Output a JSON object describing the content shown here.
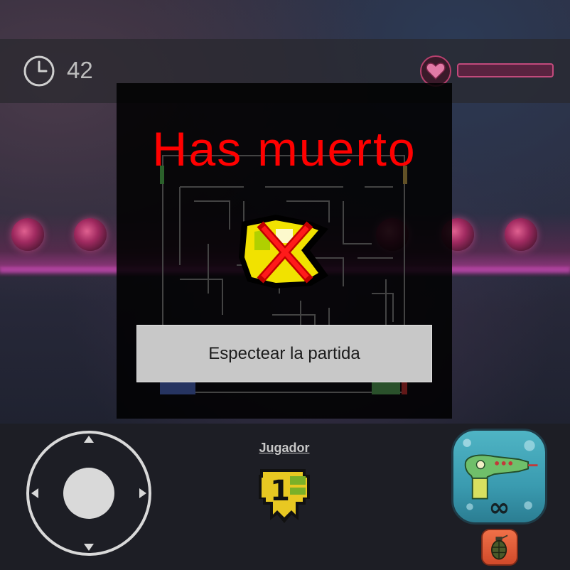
{
  "hud": {
    "timer_icon": "clock-icon",
    "timer_value": "42",
    "health_icon": "heart-icon",
    "health_fraction": 0.0
  },
  "death_dialog": {
    "title": "Has muerto",
    "avatar_icon": "dead-player-avatar",
    "spectate_button_label": "Espectear la partida"
  },
  "controls": {
    "joystick_icon": "joystick",
    "player_label": "Jugador",
    "rank_badge_icon": "rank-1-badge",
    "rank_number": "1",
    "weapon_icon": "ray-gun-icon",
    "ammo": "∞",
    "grenade_icon": "grenade-icon"
  },
  "colors": {
    "title": "#ff0000",
    "button_bg": "#c8c8c8",
    "health_border": "#c24a7c",
    "weapon_button": "#3a9bb0",
    "grenade_button": "#d04a2a"
  }
}
